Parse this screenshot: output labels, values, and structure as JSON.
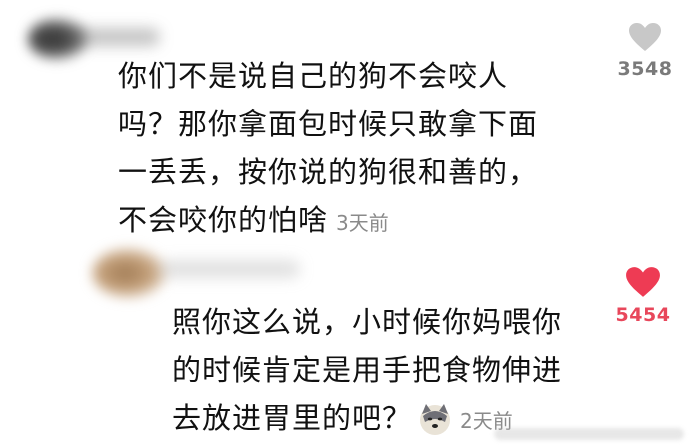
{
  "comments": [
    {
      "text": "你们不是说自己的狗不会咬人\n吗？那你拿面包时候只敢拿下面\n一丢丢，按你说的狗很和善的，\n不会咬你的怕啥",
      "time": "3天前",
      "likes": "3548",
      "liked": false,
      "avatar_icon": "blurred-avatar-icon"
    },
    {
      "text": "照你这么说，小时候你妈喂你\n的时候肯定是用手把食物伸进\n去放进胃里的吧？",
      "time": "2天前",
      "likes": "5454",
      "liked": true,
      "emoji_icon": "doge-emoji-icon",
      "avatar_icon": "blurred-avatar-icon"
    }
  ],
  "colors": {
    "heart_grey": "#c8c8c8",
    "heart_red": "#ee3b54",
    "time_grey": "#8a8a8a"
  }
}
